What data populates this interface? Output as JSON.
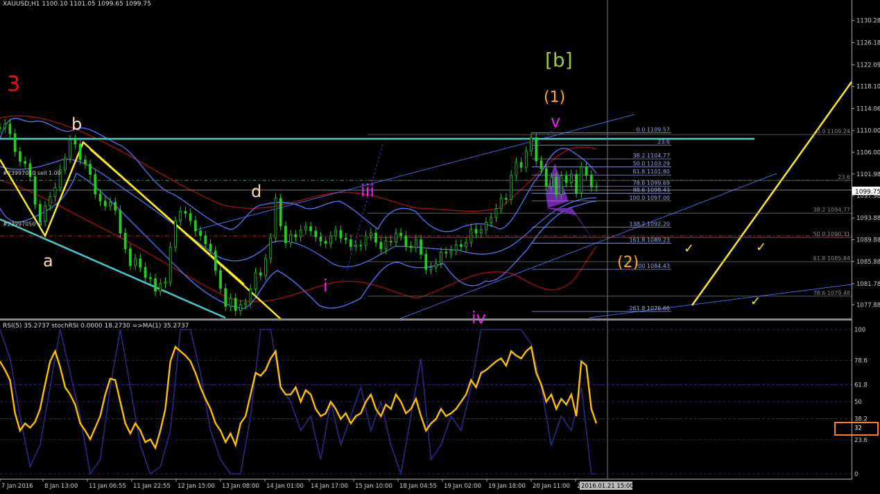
{
  "window": {
    "symbol_header": "XAUUSD,H1  1100.10 1101.05 1099.65 1099.75"
  },
  "chart_data": [
    {
      "type": "line",
      "title": "XAUUSD,H1  1100.10 1101.05 1099.65 1099.75",
      "price_axis": {
        "ylim": [
          1075.5,
          1132.5
        ],
        "ticks": [
          "1130.28",
          "1126.18",
          "1122.09",
          "1118.10",
          "1114.06",
          "1110.00",
          "1106.00",
          "1101.98",
          "1097.98",
          "1093.88",
          "1089.88",
          "1085.88",
          "1081.78",
          "1077.88"
        ],
        "current_price": "1099.75"
      },
      "time_axis": {
        "labels": [
          "7 Jan 2016",
          "8 Jan 13:00",
          "11 Jan 06:55",
          "11 Jan 22:55",
          "12 Jan 15:00",
          "13 Jan 08:00",
          "14 Jan 01:00",
          "14 Jan 17:00",
          "15 Jan 10:00",
          "18 Jan 04:55",
          "19 Jan 02:00",
          "19 Jan 18:00",
          "20 Jan 11:00",
          "2",
          "2016.01.21 15:00"
        ]
      },
      "series": [
        {
          "name": "",
          "color": "#22cc22",
          "x": [
            0,
            2,
            4,
            6,
            8,
            10,
            12,
            14,
            16,
            18,
            20,
            22,
            24,
            26,
            28,
            30,
            32,
            34,
            36,
            38,
            40,
            42,
            44,
            46,
            48,
            50,
            52,
            54,
            56,
            58,
            60,
            62,
            64,
            66,
            68,
            70,
            72,
            74,
            76,
            78,
            80,
            82,
            84,
            86,
            88,
            90,
            92,
            94,
            96,
            98,
            100,
            102,
            104,
            106,
            108,
            110,
            112,
            114,
            116,
            118,
            120,
            122,
            124,
            126,
            128,
            130,
            132,
            134,
            136,
            138,
            140,
            142,
            144,
            146,
            148,
            150,
            152,
            154,
            156,
            158,
            160,
            162,
            164,
            166,
            168,
            170,
            172,
            174,
            176,
            178,
            180,
            182,
            184,
            186,
            188,
            190,
            192,
            194,
            196,
            198,
            200,
            202,
            204,
            206,
            208,
            210,
            212,
            214,
            216,
            218,
            220,
            222,
            224,
            226,
            228,
            230,
            232,
            234,
            236,
            238
          ],
          "values": [
            1110.5,
            1111.2,
            1109.4,
            1106.1,
            1104.3,
            1103.9,
            1101.5,
            1096.4,
            1093.2,
            1096.1,
            1097.8,
            1099.5,
            1102.8,
            1104.9,
            1108.3,
            1107.5,
            1104.6,
            1103.8,
            1101.9,
            1098.3,
            1097.0,
            1096.1,
            1096.8,
            1095.3,
            1091.1,
            1088.2,
            1085.1,
            1086.4,
            1084.8,
            1082.9,
            1082.7,
            1080.4,
            1081.8,
            1082.1,
            1088.5,
            1093.3,
            1095.1,
            1094.7,
            1093.4,
            1091.5,
            1090.6,
            1089.1,
            1087.8,
            1084.2,
            1080.9,
            1077.6,
            1079.1,
            1076.8,
            1077.9,
            1078.2,
            1080.8,
            1083.8,
            1083.3,
            1086.4,
            1090.2,
            1097.5,
            1092.4,
            1089.3,
            1090.8,
            1090.4,
            1091.7,
            1092.3,
            1091.5,
            1090.4,
            1089.6,
            1089.2,
            1090.6,
            1091.6,
            1090.2,
            1089.9,
            1088.6,
            1088.9,
            1088.8,
            1090.6,
            1091.1,
            1089.4,
            1088.2,
            1089.6,
            1089.5,
            1091.1,
            1090.6,
            1088.7,
            1088.4,
            1089.9,
            1087.2,
            1084.4,
            1084.8,
            1085.5,
            1087.6,
            1087.4,
            1087.9,
            1089.0,
            1088.6,
            1089.4,
            1091.8,
            1091.1,
            1091.7,
            1093.1,
            1094.0,
            1095.6,
            1097.5,
            1097.3,
            1101.8,
            1104.1,
            1103.2,
            1106.2,
            1108.7,
            1104.4,
            1103.0,
            1099.7,
            1101.4,
            1098.2,
            1101.6,
            1100.4,
            1101.9,
            1098.5,
            1103.3,
            1101.7,
            1099.6,
            1099.75
          ]
        }
      ],
      "labels_on_chart": [
        "3",
        "b",
        "a",
        "d",
        "i",
        "iii",
        "iv",
        "v",
        "(1)",
        "[b]",
        "(2)"
      ],
      "fib_levels": [
        {
          "text": "0.0 1109.57",
          "price": 1109.57
        },
        {
          "text": "23.6",
          "price": 1107.3
        },
        {
          "text": "38.2 1104.77",
          "price": 1104.77
        },
        {
          "text": "50.0 1103.29",
          "price": 1103.29
        },
        {
          "text": "61.8 1101.80",
          "price": 1101.8
        },
        {
          "text": "78.6 1099.69",
          "price": 1099.69
        },
        {
          "text": "88.6 1098.43",
          "price": 1098.43
        },
        {
          "text": "100.0 1097.00",
          "price": 1097.0
        },
        {
          "text": "138.2 1092.20",
          "price": 1092.2
        },
        {
          "text": "161.8 1089.23",
          "price": 1089.23
        },
        {
          "text": "200 1084.43",
          "price": 1084.43
        },
        {
          "text": "261.8 1076.66",
          "price": 1076.66
        }
      ],
      "fib_levels_right": [
        {
          "text": "0.0 1109.24",
          "price": 1109.24
        },
        {
          "text": "23.6",
          "price": 1100.8
        },
        {
          "text": "38.2 1094.77",
          "price": 1094.77
        },
        {
          "text": "50.0 1090.31",
          "price": 1090.31
        },
        {
          "text": "61.8 1085.84",
          "price": 1085.84
        },
        {
          "text": "78.6 1079.48",
          "price": 1079.48
        }
      ],
      "order_lines": [
        {
          "text": "#23997010 sell 1.00",
          "price": 1101.6
        },
        {
          "text": "#23997050 sl",
          "price": 1092.2
        }
      ],
      "colors": {
        "candle": "#22cc22",
        "bollinger": "#5577ff",
        "envelope": "#aa1111",
        "trend": "#ffee22",
        "channel": "#44cccc",
        "fib": "#8899cc"
      }
    },
    {
      "type": "line",
      "title": "RSI(5) 35.2737  stochRSI 0.0000 18.2730  =>MA(1) 35.2737",
      "ylim": [
        0,
        100
      ],
      "ticks": [
        "100",
        "78.6",
        "61.8",
        "50",
        "38.2",
        "32",
        "23.6",
        "0"
      ],
      "highlighted_value": "32",
      "series": [
        {
          "name": "RSI(5)",
          "color": "#ffc000",
          "x": [
            0,
            2,
            4,
            6,
            8,
            10,
            12,
            14,
            16,
            18,
            20,
            22,
            24,
            26,
            28,
            30,
            32,
            34,
            36,
            38,
            40,
            42,
            44,
            46,
            48,
            50,
            52,
            54,
            56,
            58,
            60,
            62,
            64,
            66,
            68,
            70,
            72,
            74,
            76,
            78,
            80,
            82,
            84,
            86,
            88,
            90,
            92,
            94,
            96,
            98,
            100,
            102,
            104,
            106,
            108,
            110,
            112,
            114,
            116,
            118,
            120,
            122,
            124,
            126,
            128,
            130,
            132,
            134,
            136,
            138,
            140,
            142,
            144,
            146,
            148,
            150,
            152,
            154,
            156,
            158,
            160,
            162,
            164,
            166,
            168,
            170,
            172,
            174,
            176,
            178,
            180,
            182,
            184,
            186,
            188,
            190,
            192,
            194,
            196,
            198,
            200,
            202,
            204,
            206,
            208,
            210,
            212,
            214,
            216,
            218,
            220,
            222,
            224,
            226,
            228,
            230,
            232,
            234,
            236,
            238
          ],
          "values": [
            78,
            72,
            65,
            42,
            30,
            35,
            32,
            36,
            45,
            62,
            78,
            85,
            74,
            60,
            55,
            48,
            35,
            30,
            24,
            32,
            40,
            55,
            66,
            65,
            50,
            35,
            28,
            35,
            30,
            22,
            24,
            18,
            30,
            45,
            78,
            88,
            85,
            82,
            78,
            70,
            60,
            52,
            45,
            35,
            30,
            22,
            28,
            20,
            35,
            40,
            55,
            70,
            68,
            72,
            80,
            85,
            60,
            55,
            55,
            60,
            50,
            58,
            55,
            45,
            40,
            42,
            50,
            45,
            38,
            42,
            35,
            40,
            42,
            50,
            55,
            45,
            40,
            48,
            45,
            55,
            50,
            42,
            45,
            52,
            40,
            30,
            35,
            38,
            45,
            40,
            42,
            45,
            50,
            55,
            65,
            60,
            70,
            72,
            75,
            78,
            80,
            75,
            85,
            82,
            80,
            85,
            88,
            70,
            62,
            50,
            55,
            45,
            52,
            48,
            55,
            40,
            78,
            75,
            45,
            35
          ]
        },
        {
          "name": "stochRSI",
          "color": "#2a2a8a",
          "x": [
            0,
            4,
            8,
            12,
            16,
            20,
            24,
            28,
            32,
            36,
            40,
            44,
            48,
            52,
            56,
            60,
            64,
            68,
            72,
            76,
            80,
            84,
            88,
            92,
            96,
            100,
            104,
            108,
            112,
            116,
            120,
            124,
            128,
            132,
            136,
            140,
            144,
            148,
            152,
            156,
            160,
            164,
            168,
            172,
            176,
            180,
            184,
            188,
            192,
            196,
            200,
            204,
            208,
            212,
            216,
            220,
            224,
            228,
            232,
            236,
            238
          ],
          "values": [
            100,
            80,
            40,
            5,
            20,
            60,
            100,
            70,
            40,
            0,
            10,
            60,
            100,
            60,
            20,
            0,
            5,
            30,
            100,
            100,
            70,
            30,
            10,
            0,
            0,
            40,
            100,
            100,
            60,
            50,
            30,
            40,
            10,
            50,
            20,
            40,
            60,
            30,
            50,
            20,
            0,
            40,
            80,
            10,
            20,
            40,
            30,
            60,
            100,
            100,
            100,
            100,
            100,
            90,
            60,
            20,
            40,
            30,
            60,
            0,
            0
          ]
        }
      ]
    }
  ]
}
